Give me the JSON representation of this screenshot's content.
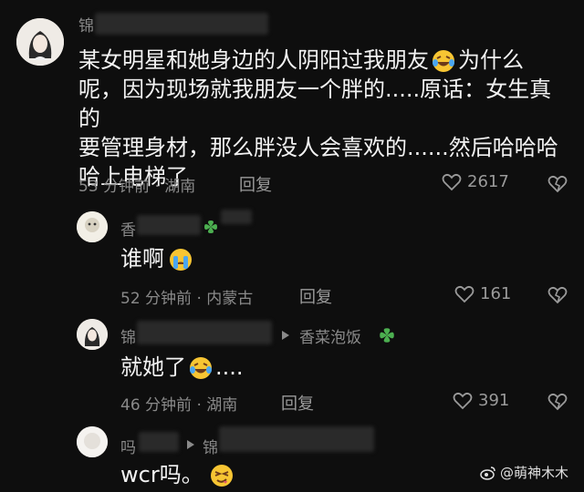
{
  "comments": [
    {
      "name_visible": "锦",
      "text_line1": "某女明星和她身边的人阴阳过我朋友",
      "text_line1_tail": "为什么",
      "text_line2": "呢，因为现场就我朋友一个胖的.....原话：女生真的",
      "text_line3": "要管理身材，那么胖没人会喜欢的......然后哈哈哈",
      "text_line4": "哈上电梯了",
      "time_location": "53 分钟前 · 湖南",
      "reply_label": "回复",
      "likes": "2617"
    },
    {
      "name_visible": "香",
      "text": "谁啊",
      "time_location": "52 分钟前 · 内蒙古",
      "reply_label": "回复",
      "likes": "161"
    },
    {
      "name_visible": "锦",
      "reply_to": "香菜泡饭",
      "text": "就她了",
      "text_tail": "....",
      "time_location": "46 分钟前 · 湖南",
      "reply_label": "回复",
      "likes": "391"
    },
    {
      "name_visible": "吗",
      "reply_to_visible": "锦",
      "text": "wcr吗。"
    }
  ],
  "watermark": "@萌神木木",
  "icons": [
    "heart-outline-icon",
    "broken-heart-icon",
    "laugh-cry-emoji",
    "sob-emoji",
    "squint-emoji",
    "clover-icon",
    "reply-arrow-icon",
    "weibo-icon"
  ]
}
